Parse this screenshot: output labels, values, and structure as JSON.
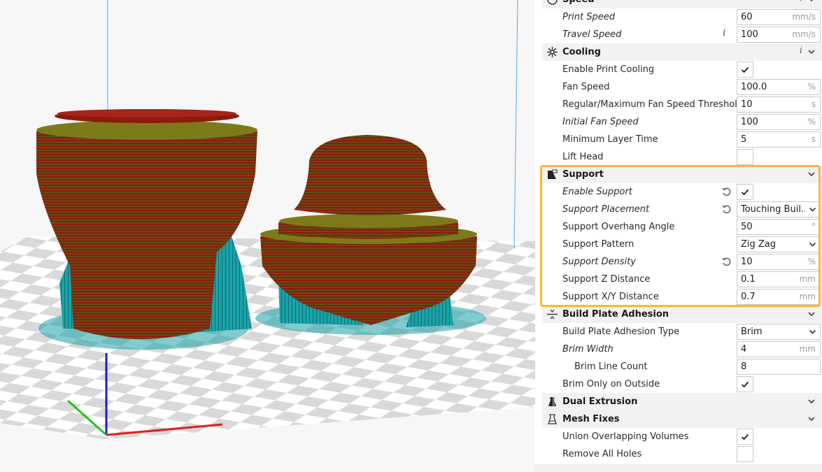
{
  "speed": {
    "header_label": "Speed",
    "print_speed": {
      "label": "Print Speed",
      "value": "60",
      "unit": "mm/s"
    },
    "travel_speed": {
      "label": "Travel Speed",
      "value": "100",
      "unit": "mm/s"
    }
  },
  "cooling": {
    "header_label": "Cooling",
    "enable_print_cooling": {
      "label": "Enable Print Cooling",
      "checked": true
    },
    "fan_speed": {
      "label": "Fan Speed",
      "value": "100.0",
      "unit": "%"
    },
    "fan_threshold": {
      "label": "Regular/Maximum Fan Speed Threshold",
      "value": "10",
      "unit": "s"
    },
    "initial_fan_speed": {
      "label": "Initial Fan Speed",
      "value": "100",
      "unit": "%"
    },
    "min_layer_time": {
      "label": "Minimum Layer Time",
      "value": "5",
      "unit": "s"
    },
    "lift_head": {
      "label": "Lift Head",
      "checked": false
    }
  },
  "support": {
    "header_label": "Support",
    "enable_support": {
      "label": "Enable Support",
      "checked": true
    },
    "placement": {
      "label": "Support Placement",
      "value": "Touching Buil..."
    },
    "overhang_angle": {
      "label": "Support Overhang Angle",
      "value": "50",
      "unit": "°"
    },
    "pattern": {
      "label": "Support Pattern",
      "value": "Zig Zag"
    },
    "density": {
      "label": "Support Density",
      "value": "10",
      "unit": "%"
    },
    "z_distance": {
      "label": "Support Z Distance",
      "value": "0.1",
      "unit": "mm"
    },
    "xy_distance": {
      "label": "Support X/Y Distance",
      "value": "0.7",
      "unit": "mm"
    }
  },
  "adhesion": {
    "header_label": "Build Plate Adhesion",
    "type": {
      "label": "Build Plate Adhesion Type",
      "value": "Brim"
    },
    "brim_width": {
      "label": "Brim Width",
      "value": "4",
      "unit": "mm"
    },
    "brim_line_count": {
      "label": "Brim Line Count",
      "value": "8"
    },
    "brim_only_outside": {
      "label": "Brim Only on Outside",
      "checked": true
    }
  },
  "dual_extrusion": {
    "header_label": "Dual Extrusion"
  },
  "mesh_fixes": {
    "header_label": "Mesh Fixes",
    "union_volumes": {
      "label": "Union Overlapping Volumes",
      "checked": true
    },
    "remove_holes": {
      "label": "Remove All Holes",
      "checked": false
    }
  },
  "icons": {
    "info": "i",
    "expand": "chevron-down-icon",
    "reset": "reset-icon"
  },
  "colors": {
    "highlight": "#fbb833",
    "model_wall": "#9b1b0c",
    "model_top": "#7d7a1a",
    "support": "#11959c",
    "axis_x": "#e0201c",
    "axis_y": "#23c21f",
    "axis_z": "#1b1bd6"
  }
}
